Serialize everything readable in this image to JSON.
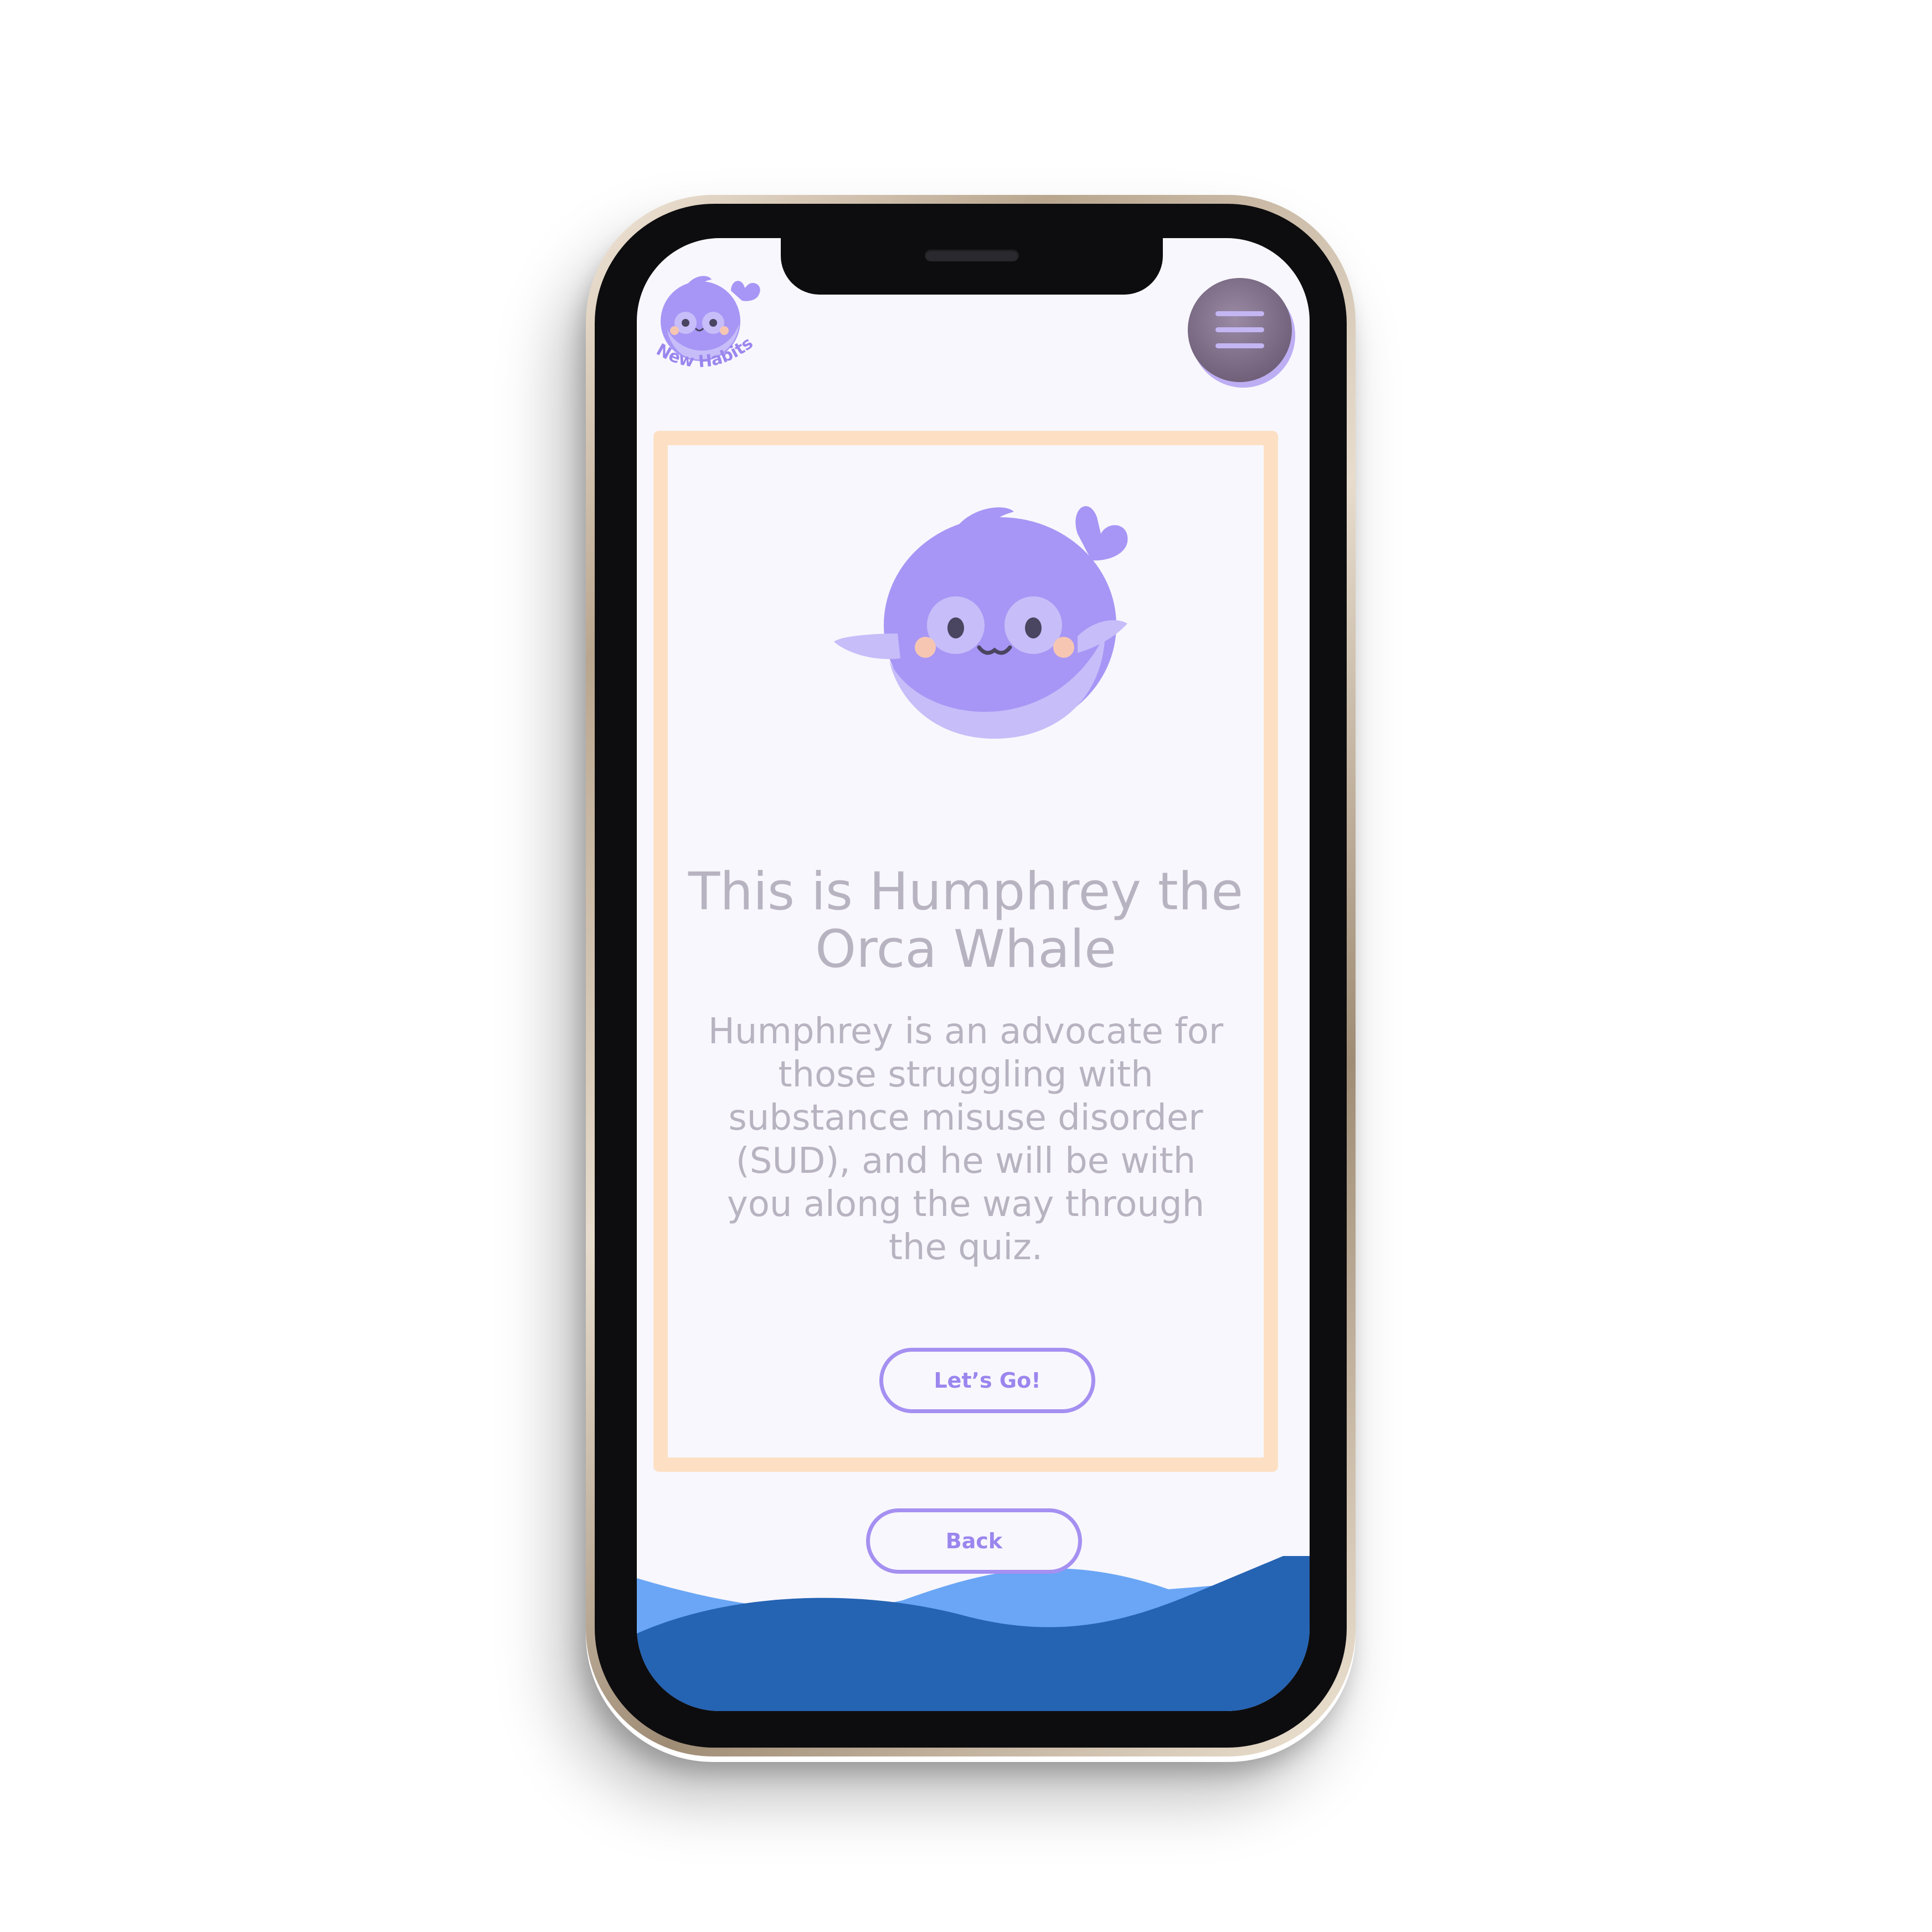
{
  "app": {
    "logo_text": "New Habits"
  },
  "header": {
    "menu_icon": "hamburger-menu-icon"
  },
  "intro_card": {
    "mascot_icon": "orca-whale-icon",
    "title": "This is Humphrey the Orca Whale",
    "body": "Humphrey is an advocate for those struggling with substance misuse disorder (SUD), and he will be with you along the way through the quiz.",
    "primary_button_label": "Let’s Go!"
  },
  "footer": {
    "back_button_label": "Back"
  },
  "colors": {
    "background": "#f8f7fd",
    "card_border": "#fde0c4",
    "accent_purple": "#a590f1",
    "text_muted": "#b8b3c0",
    "wave_light": "#6aa6f5",
    "wave_dark": "#2563b3"
  }
}
